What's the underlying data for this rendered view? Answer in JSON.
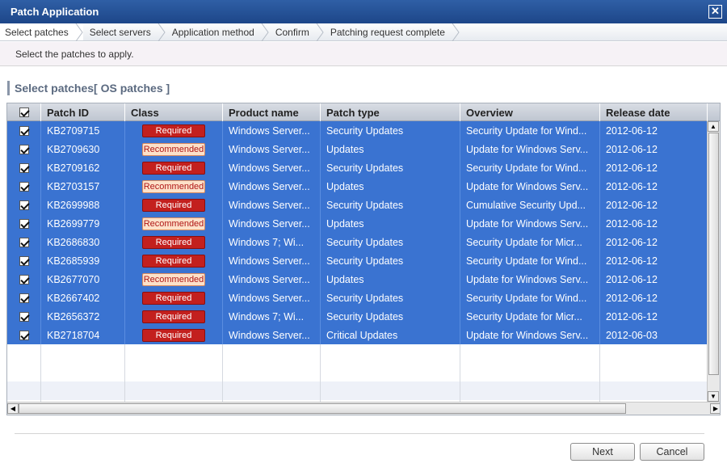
{
  "window": {
    "title": "Patch Application"
  },
  "steps": [
    "Select patches",
    "Select servers",
    "Application method",
    "Confirm",
    "Patching request complete"
  ],
  "instruction": "Select the patches to apply.",
  "section_title": "Select patches[ OS patches ]",
  "table": {
    "columns": [
      "",
      "Patch ID",
      "Class",
      "Product name",
      "Patch type",
      "Overview",
      "Release date"
    ],
    "rows": [
      {
        "id": "KB2709715",
        "class": "Required",
        "product": "Windows Server...",
        "type": "Security Updates",
        "overview": "Security Update for Wind...",
        "date": "2012-06-12"
      },
      {
        "id": "KB2709630",
        "class": "Recommended",
        "product": "Windows Server...",
        "type": "Updates",
        "overview": "Update for Windows Serv...",
        "date": "2012-06-12"
      },
      {
        "id": "KB2709162",
        "class": "Required",
        "product": "Windows Server...",
        "type": "Security Updates",
        "overview": "Security Update for Wind...",
        "date": "2012-06-12"
      },
      {
        "id": "KB2703157",
        "class": "Recommended",
        "product": "Windows Server...",
        "type": "Updates",
        "overview": "Update for Windows Serv...",
        "date": "2012-06-12"
      },
      {
        "id": "KB2699988",
        "class": "Required",
        "product": "Windows Server...",
        "type": "Security Updates",
        "overview": "Cumulative Security Upd...",
        "date": "2012-06-12"
      },
      {
        "id": "KB2699779",
        "class": "Recommended",
        "product": "Windows Server...",
        "type": "Updates",
        "overview": "Update for Windows Serv...",
        "date": "2012-06-12"
      },
      {
        "id": "KB2686830",
        "class": "Required",
        "product": "Windows 7; Wi...",
        "type": "Security Updates",
        "overview": "Security Update for Micr...",
        "date": "2012-06-12"
      },
      {
        "id": "KB2685939",
        "class": "Required",
        "product": "Windows Server...",
        "type": "Security Updates",
        "overview": "Security Update for Wind...",
        "date": "2012-06-12"
      },
      {
        "id": "KB2677070",
        "class": "Recommended",
        "product": "Windows Server...",
        "type": "Updates",
        "overview": "Update for Windows Serv...",
        "date": "2012-06-12"
      },
      {
        "id": "KB2667402",
        "class": "Required",
        "product": "Windows Server...",
        "type": "Security Updates",
        "overview": "Security Update for Wind...",
        "date": "2012-06-12"
      },
      {
        "id": "KB2656372",
        "class": "Required",
        "product": "Windows 7; Wi...",
        "type": "Security Updates",
        "overview": "Security Update for Micr...",
        "date": "2012-06-12"
      },
      {
        "id": "KB2718704",
        "class": "Required",
        "product": "Windows Server...",
        "type": "Critical Updates",
        "overview": "Update for Windows Serv...",
        "date": "2012-06-03"
      }
    ]
  },
  "buttons": {
    "next": "Next",
    "cancel": "Cancel"
  },
  "colors": {
    "title_bar": "#1d4689",
    "selection": "#3a73d1",
    "required": "#c3201e",
    "recommended": "#fde1c9"
  }
}
